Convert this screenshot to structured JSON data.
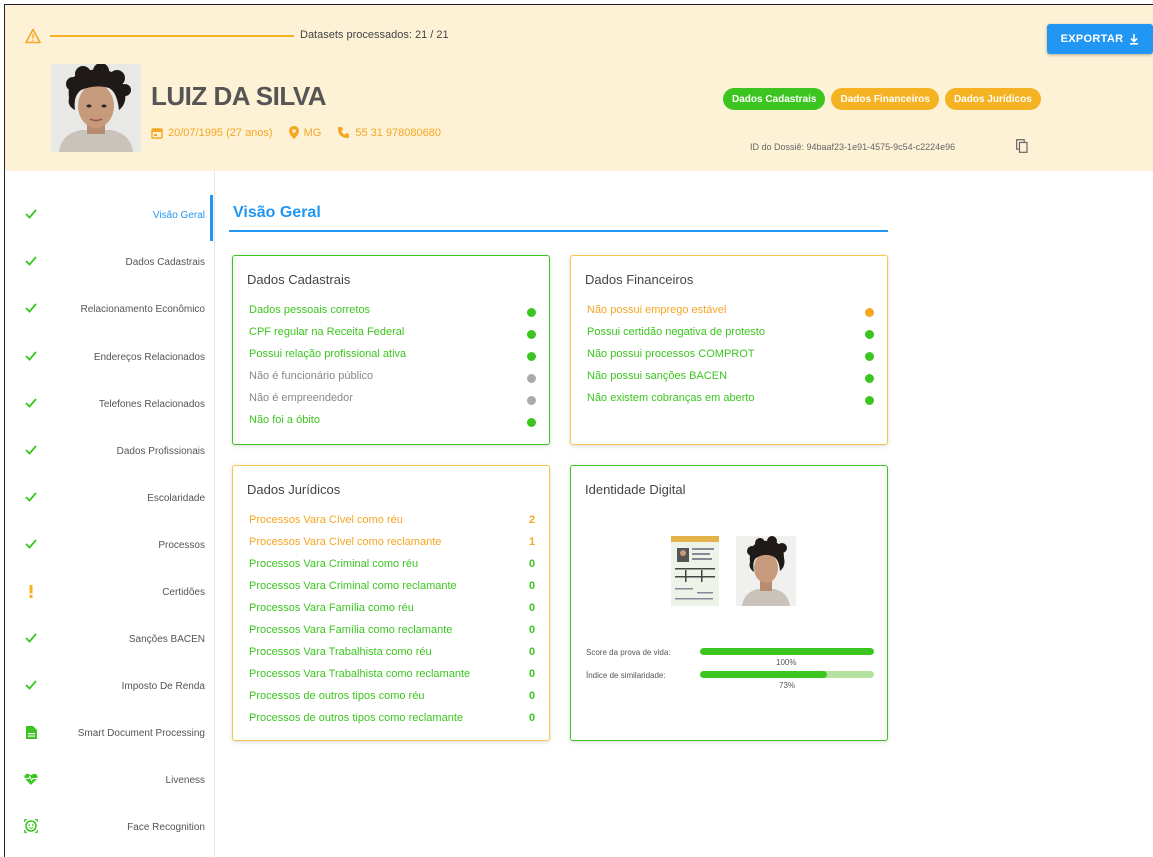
{
  "header": {
    "datasets": "Datasets processados: 21 / 21",
    "export_label": "EXPORTAR",
    "name": "LUIZ DA SILVA",
    "birth": "20/07/1995 (27 anos)",
    "state": "MG",
    "phone": "55 31 978080680",
    "badges": [
      {
        "label": "Dados Cadastrais",
        "color": "#3cc520"
      },
      {
        "label": "Dados Financeiros",
        "color": "#f5b323"
      },
      {
        "label": "Dados Jurídicos",
        "color": "#f5b323"
      }
    ],
    "dossie": "ID do Dossiê: 94baaf23-1e91-4575-9c54-c2224e96"
  },
  "sidebar": {
    "items": [
      {
        "label": "Visão Geral",
        "icon": "check-icon",
        "active": true
      },
      {
        "label": "Dados Cadastrais",
        "icon": "check-icon"
      },
      {
        "label": "Relacionamento Econômico",
        "icon": "check-icon"
      },
      {
        "label": "Endereços Relacionados",
        "icon": "check-icon"
      },
      {
        "label": "Telefones Relacionados",
        "icon": "check-icon"
      },
      {
        "label": "Dados Profissionais",
        "icon": "check-icon"
      },
      {
        "label": "Escolaridade",
        "icon": "check-icon"
      },
      {
        "label": "Processos",
        "icon": "check-icon"
      },
      {
        "label": "Certidões",
        "icon": "exclamation-icon"
      },
      {
        "label": "Sanções BACEN",
        "icon": "check-icon"
      },
      {
        "label": "Imposto De Renda",
        "icon": "check-icon"
      },
      {
        "label": "Smart Document Processing",
        "icon": "document-icon"
      },
      {
        "label": "Liveness",
        "icon": "heartbeat-icon"
      },
      {
        "label": "Face Recognition",
        "icon": "face-scan-icon"
      }
    ]
  },
  "main": {
    "title": "Visão Geral",
    "cadastrais": {
      "title": "Dados Cadastrais",
      "rows": [
        {
          "label": "Dados pessoais corretos",
          "status": "green"
        },
        {
          "label": "CPF regular na Receita Federal",
          "status": "green"
        },
        {
          "label": "Possui relação profissional ativa",
          "status": "green"
        },
        {
          "label": "Não é funcionário público",
          "status": "gray"
        },
        {
          "label": "Não é empreendedor",
          "status": "gray"
        },
        {
          "label": "Não foi a óbito",
          "status": "green"
        }
      ]
    },
    "financeiros": {
      "title": "Dados Financeiros",
      "rows": [
        {
          "label": "Não possui emprego estável",
          "status": "orange"
        },
        {
          "label": "Possui certidão negativa de protesto",
          "status": "green"
        },
        {
          "label": "Não possui processos COMPROT",
          "status": "green"
        },
        {
          "label": "Não possui sanções BACEN",
          "status": "green"
        },
        {
          "label": "Não existem cobranças em aberto",
          "status": "green"
        }
      ]
    },
    "juridicos": {
      "title": "Dados Jurídicos",
      "rows": [
        {
          "label": "Processos Vara Cível como réu",
          "value": "2",
          "status": "orange"
        },
        {
          "label": "Processos Vara Cível como reclamante",
          "value": "1",
          "status": "orange"
        },
        {
          "label": "Processos Vara Criminal como réu",
          "value": "0",
          "status": "green"
        },
        {
          "label": "Processos Vara Criminal como reclamante",
          "value": "0",
          "status": "green"
        },
        {
          "label": "Processos Vara Família como réu",
          "value": "0",
          "status": "green"
        },
        {
          "label": "Processos Vara Família como reclamante",
          "value": "0",
          "status": "green"
        },
        {
          "label": "Processos Vara Trabalhista como réu",
          "value": "0",
          "status": "green"
        },
        {
          "label": "Processos Vara Trabalhista como reclamante",
          "value": "0",
          "status": "green"
        },
        {
          "label": "Processos de outros tipos como réu",
          "value": "0",
          "status": "green"
        },
        {
          "label": "Processos de outros tipos como reclamante",
          "value": "0",
          "status": "green"
        }
      ]
    },
    "identidade": {
      "title": "Identidade Digital",
      "liveness_label": "Score da prova de vida:",
      "liveness_value": "100%",
      "liveness_fraction": 1.0,
      "similarity_label": "Índice de similaridade:",
      "similarity_value": "73%",
      "similarity_fraction": 0.73
    }
  },
  "colors": {
    "accent": "#2196f3",
    "green": "#3cc520",
    "orange": "#f5a623",
    "header_bg": "#fdf2d6"
  }
}
